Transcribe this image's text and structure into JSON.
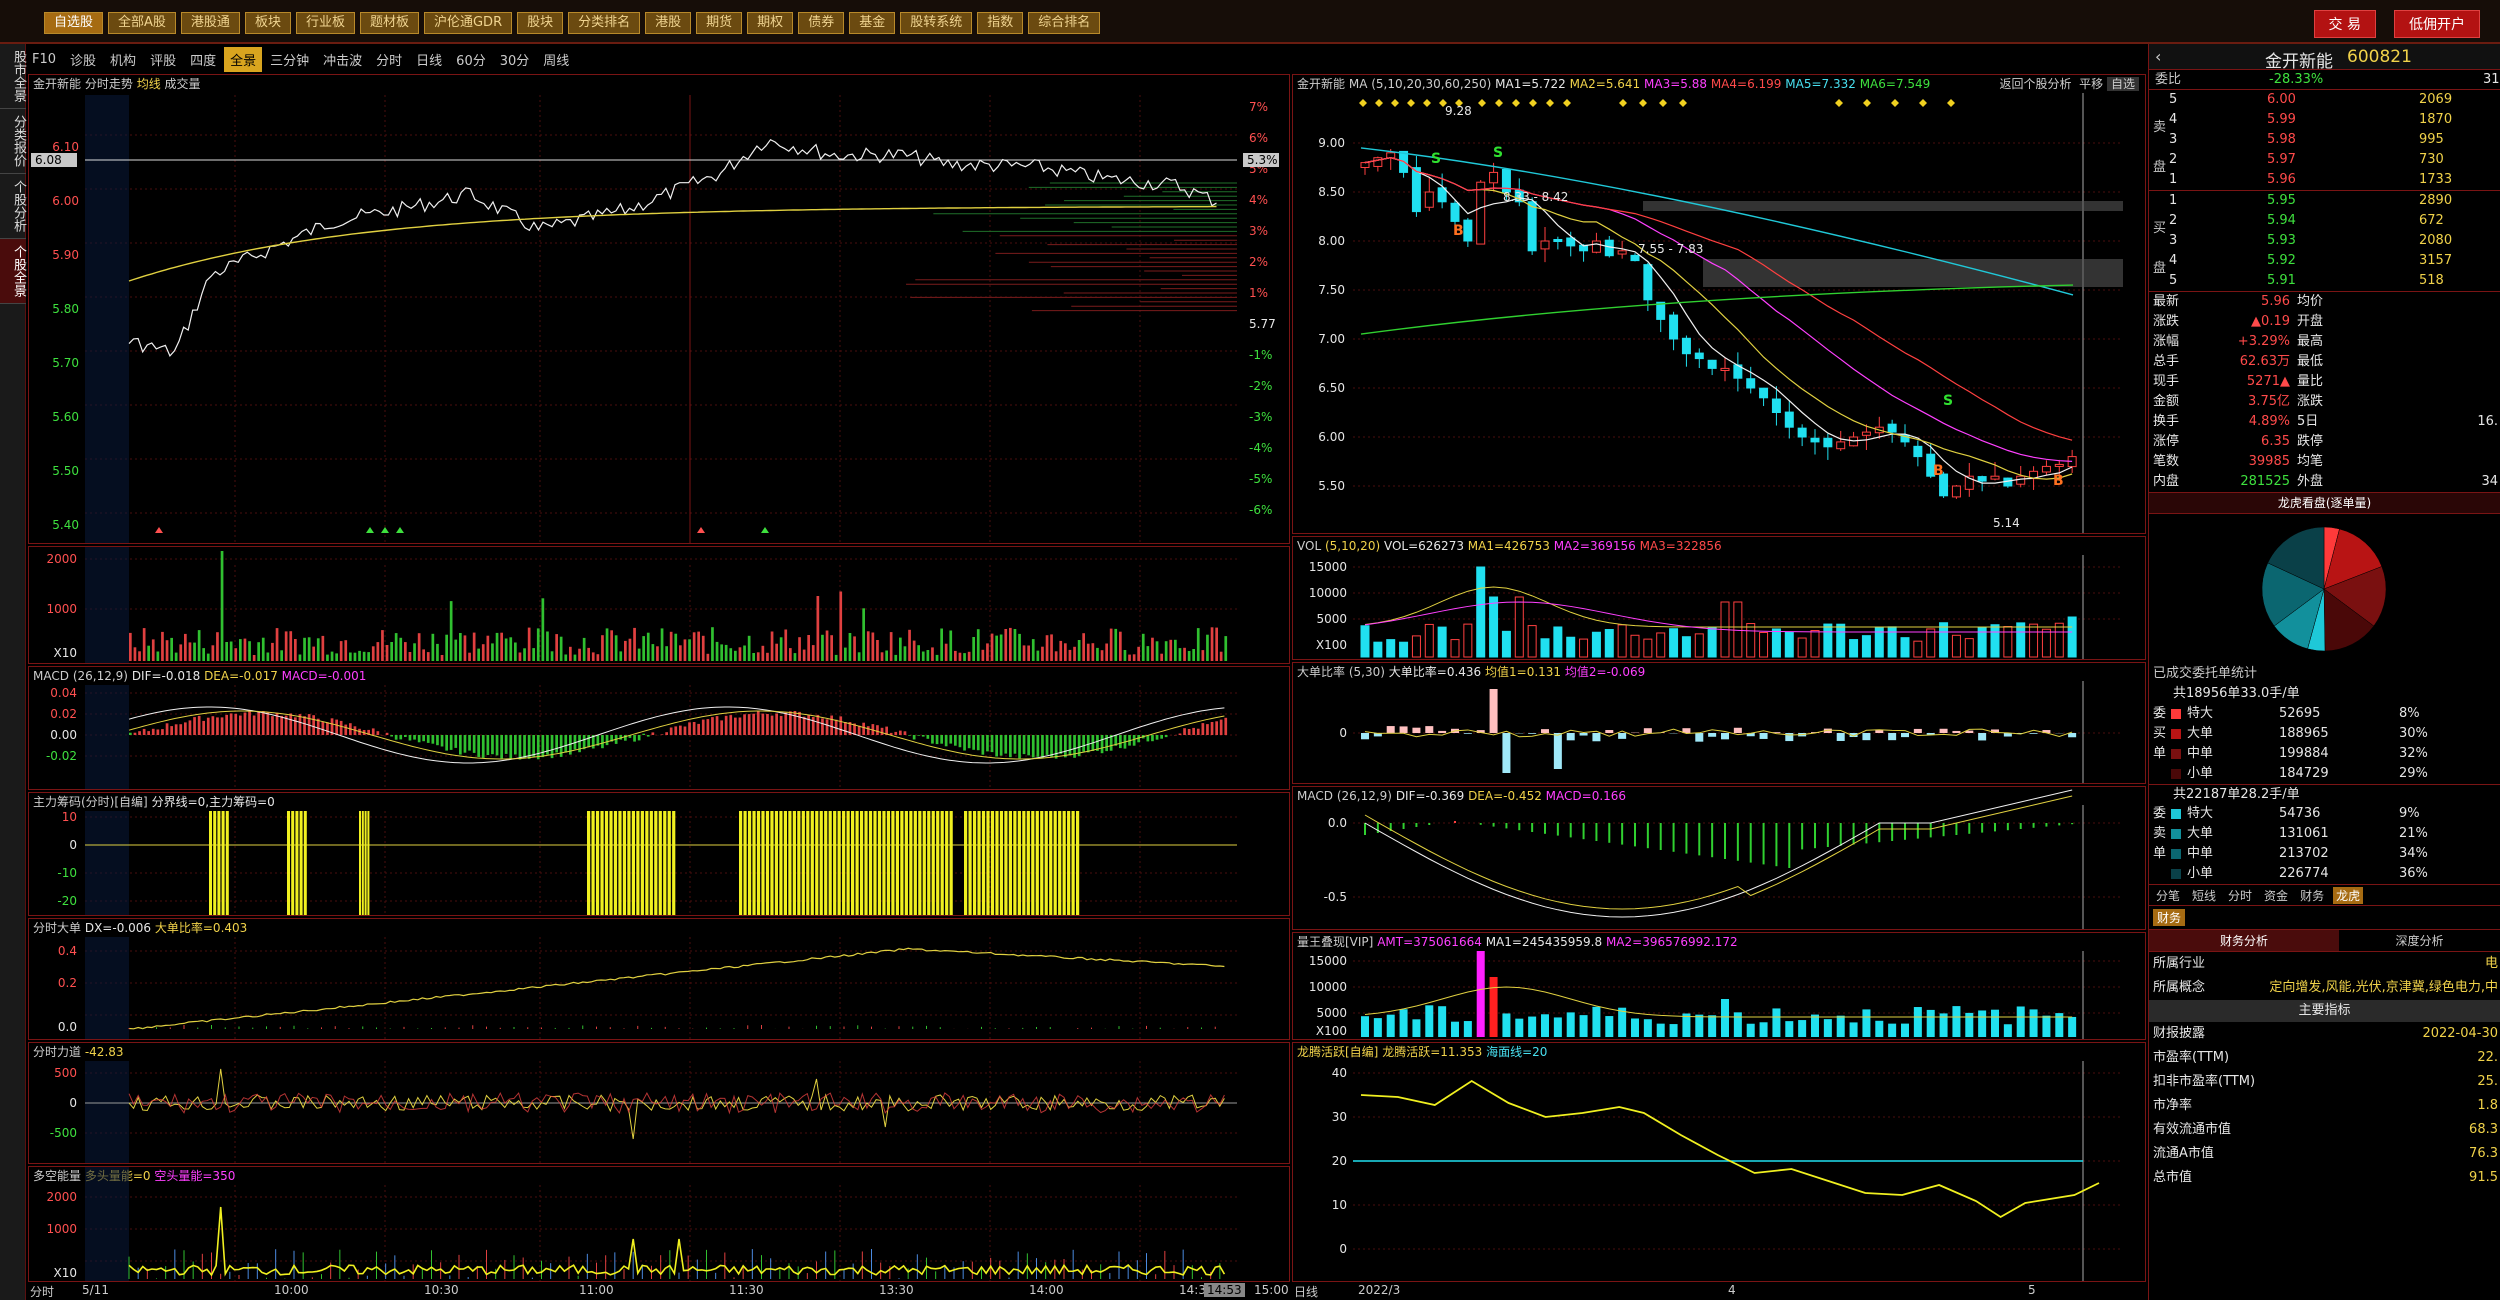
{
  "toolbar": {
    "items": [
      "自选股",
      "全部A股",
      "港股通",
      "板块",
      "行业板",
      "题材板",
      "沪伦通GDR",
      "股块",
      "分类排名",
      "港股",
      "期货",
      "期权",
      "债券",
      "基金",
      "股转系统",
      "指数",
      "综合排名"
    ],
    "trade": "交 易",
    "open": "低佣开户"
  },
  "sidebar": {
    "tabs": [
      "股市全景",
      "分类报价",
      "个股分析",
      "个股全景"
    ]
  },
  "tabs": [
    "F10",
    "诊股",
    "机构",
    "评股",
    "四度",
    "全景",
    "三分钟",
    "冲击波",
    "分时",
    "日线",
    "60分",
    "30分",
    "周线"
  ],
  "intraday": {
    "title": "金开新能",
    "sub": "分时走势",
    "avg_label": "均线",
    "vol_label": "成交量",
    "price": "6.08",
    "pct": "5.3%",
    "price_ticks": [
      "6.10",
      "6.00",
      "5.90",
      "5.80",
      "5.70",
      "5.60",
      "5.50",
      "5.40"
    ],
    "pct_ticks": [
      "7%",
      "6%",
      "5%",
      "4%",
      "3%",
      "2%",
      "1%",
      "5.77",
      "-1%",
      "-2%",
      "-3%",
      "-4%",
      "-5%",
      "-6%"
    ],
    "vol_ticks": [
      "2000",
      "1000",
      "X10"
    ],
    "macd_label": "MACD",
    "macd_params": "(26,12,9)",
    "dif": "DIF=-0.018",
    "dea": "DEA=-0.017",
    "macd": "MACD=-0.001",
    "macd_ticks": [
      "0.04",
      "0.02",
      "0.00",
      "-0.02"
    ],
    "zl": "主力筹码(分时)[自编]",
    "zl_val": "分界线=0,主力筹码=0",
    "zl_ticks": [
      "10",
      "0",
      "-10",
      "-20"
    ],
    "dd": "分时大单",
    "dd_dx": "DX=-0.006",
    "dd_ratio": "大单比率=0.403",
    "dd_ticks": [
      "0.4",
      "0.2",
      "0.0"
    ],
    "ld": "分时力道",
    "ld_val": "-42.83",
    "ld_ticks": [
      "500",
      "0",
      "-500"
    ],
    "dk": "多空能量",
    "dk_val": "多头量能=0",
    "dk_val2": "空头量能=350",
    "dk_ticks": [
      "2000",
      "1000",
      "X10"
    ],
    "times": [
      "5/11",
      "10:00",
      "10:30",
      "11:00",
      "11:30",
      "13:30",
      "14:00",
      "14:30",
      "14:53",
      "15:00"
    ],
    "foot": "分时"
  },
  "daily": {
    "title": "金开新能",
    "ma": "MA",
    "params": "(5,10,20,30,60,250)",
    "ma1": "MA1=5.722",
    "ma2": "MA2=5.641",
    "ma3": "MA3=5.88",
    "ma4": "MA4=6.199",
    "ma5": "MA5=7.332",
    "ma6": "MA6=7.549",
    "right_title": "返回个股分析",
    "flat": "平移",
    "zx": "自选",
    "ticks": [
      "9.00",
      "8.50",
      "8.00",
      "7.50",
      "7.00",
      "6.50",
      "6.00",
      "5.50"
    ],
    "ann_high": "9.28",
    "ann_r1": "8.33 - 8.42",
    "ann_r2": "7.55 - 7.83",
    "ann_low": "5.14",
    "vol": "VOL",
    "vol_params": "(5,10,20)",
    "vol_v": "VOL=626273",
    "vol_m1": "MA1=426753",
    "vol_m2": "MA2=369156",
    "vol_m3": "MA3=322856",
    "vol_ticks": [
      "15000",
      "10000",
      "5000",
      "X100"
    ],
    "dd": "大单比率",
    "dd_params": "(5,30)",
    "dd_v": "大单比率=0.436",
    "dd_m1": "均值1=0.131",
    "dd_m2": "均值2=-0.069",
    "macd": "MACD",
    "macd_params": "(26,12,9)",
    "dif": "DIF=-0.369",
    "dea": "DEA=-0.452",
    "mv": "MACD=0.166",
    "macd_ticks": [
      "0.0",
      "-0.5"
    ],
    "amt": "量王叠现[VIP]",
    "amt_v": "AMT=375061664",
    "amt_m1": "MA1=245435959.8",
    "amt_m2": "MA2=396576992.172",
    "amt_ticks": [
      "15000",
      "10000",
      "5000",
      "X100"
    ],
    "lt": "龙腾活跃[自编]",
    "lt_v": "龙腾活跃=11.353",
    "lt_s": "海面线=20",
    "lt_ticks": [
      "40",
      "30",
      "20",
      "10",
      "0"
    ],
    "dates": [
      "2022/3",
      "4",
      "5"
    ],
    "foot": "日线"
  },
  "right": {
    "name": "金开新能",
    "code": "600821",
    "wb_label": "委比",
    "wb": "-28.33%",
    "wb_end": "31",
    "sell": [
      [
        "5",
        "6.00",
        "2069"
      ],
      [
        "4",
        "5.99",
        "1870"
      ],
      [
        "3",
        "5.98",
        "995"
      ],
      [
        "2",
        "5.97",
        "730"
      ],
      [
        "1",
        "5.96",
        "1733"
      ]
    ],
    "buy": [
      [
        "1",
        "5.95",
        "2890"
      ],
      [
        "2",
        "5.94",
        "672"
      ],
      [
        "3",
        "5.93",
        "2080"
      ],
      [
        "4",
        "5.92",
        "3157"
      ],
      [
        "5",
        "5.91",
        "518"
      ]
    ],
    "sell_lbl": "卖",
    "buy_lbl": "买",
    "pan_lbl": "盘",
    "stats": [
      [
        "最新",
        "5.96",
        "均价",
        ""
      ],
      [
        "涨跌",
        "▲0.19",
        "开盘",
        ""
      ],
      [
        "涨幅",
        "+3.29%",
        "最高",
        ""
      ],
      [
        "总手",
        "62.63万",
        "最低",
        ""
      ],
      [
        "现手",
        "5271▲",
        "量比",
        ""
      ],
      [
        "金额",
        "3.75亿",
        "涨跌",
        ""
      ],
      [
        "换手",
        "4.89%",
        "5日",
        "16."
      ],
      [
        "涨停",
        "6.35",
        "跌停",
        ""
      ],
      [
        "笔数",
        "39985",
        "均笔",
        ""
      ],
      [
        "内盘",
        "281525",
        "外盘",
        "34"
      ]
    ],
    "pie_title": "龙虎看盘(逐单量)",
    "pie_slices": [
      {
        "v": 8,
        "c": "#ff3a3a"
      },
      {
        "v": 30,
        "c": "#b81414"
      },
      {
        "v": 32,
        "c": "#7a1010"
      },
      {
        "v": 29,
        "c": "#4a0808"
      },
      {
        "v": 9,
        "c": "#1ec8d8"
      },
      {
        "v": 21,
        "c": "#12909c"
      },
      {
        "v": 34,
        "c": "#0b6670"
      },
      {
        "v": 36,
        "c": "#0a4048"
      }
    ],
    "tj_title": "已成交委托单统计",
    "buy_total": "共18956单33.0手/单",
    "sell_total": "共22187单28.2手/单",
    "buy_rows": [
      [
        "特大",
        "52695",
        "8%"
      ],
      [
        "大单",
        "188965",
        "30%"
      ],
      [
        "中单",
        "199884",
        "32%"
      ],
      [
        "小单",
        "184729",
        "29%"
      ]
    ],
    "sell_rows": [
      [
        "特大",
        "54736",
        "9%"
      ],
      [
        "大单",
        "131061",
        "21%"
      ],
      [
        "中单",
        "213702",
        "34%"
      ],
      [
        "小单",
        "226774",
        "36%"
      ]
    ],
    "side_buy": [
      "委",
      "买",
      "单"
    ],
    "side_sell": [
      "委",
      "卖",
      "单"
    ],
    "small_tabs": [
      "分笔",
      "短线",
      "分时",
      "资金",
      "财务",
      "龙虎"
    ],
    "fin_tab": "财务",
    "fin_sub": "财务分析",
    "depth": "深度分析",
    "fin_rows": [
      [
        "所属行业",
        "电"
      ],
      [
        "所属概念",
        "定向增发,风能,光伏,京津冀,绿色电力,中"
      ]
    ],
    "zy": "主要指标",
    "zy_rows": [
      [
        "财报披露",
        "2022-04-30"
      ],
      [
        "市盈率(TTM)",
        "22."
      ],
      [
        "扣非市盈率(TTM)",
        "25."
      ],
      [
        "市净率",
        "1.8"
      ],
      [
        "有效流通市值",
        "68.3"
      ],
      [
        "流通A市值",
        "76.3"
      ],
      [
        "总市值",
        "91.5"
      ]
    ]
  }
}
